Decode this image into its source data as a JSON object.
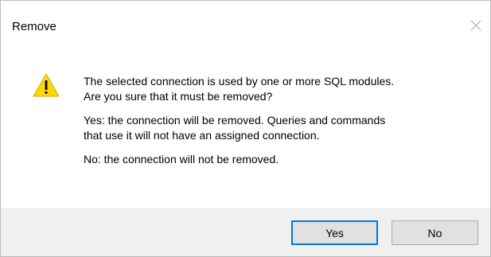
{
  "window": {
    "title": "Remove",
    "close_icon": "close-icon"
  },
  "dialog": {
    "icon": "warning-icon",
    "accent_color": "#0078d7",
    "messages": [
      "The selected connection is used by one or more SQL modules.\nAre you sure that it must be removed?",
      "Yes: the connection will be removed. Queries and commands\nthat use it will not have an assigned connection.",
      "No: the connection will not be removed."
    ]
  },
  "buttons": {
    "yes_label": "Yes",
    "no_label": "No",
    "default": "yes"
  }
}
